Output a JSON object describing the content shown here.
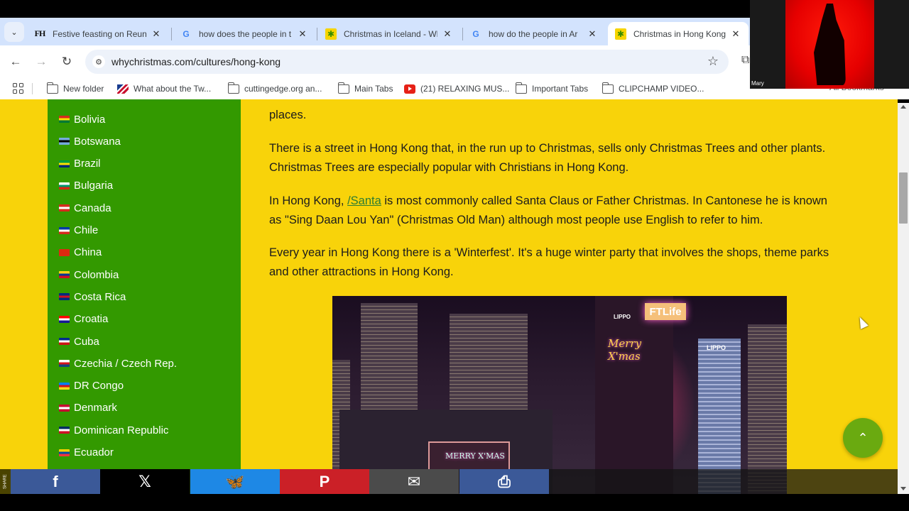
{
  "browser": {
    "tabs": [
      {
        "favicon": "fh-logo-icon",
        "title": "Festive feasting on Reunio",
        "active": false
      },
      {
        "favicon": "google-icon",
        "title": "how does the people in t",
        "active": false
      },
      {
        "favicon": "whychristmas-tree-icon",
        "title": "Christmas in Iceland - Wh",
        "active": false
      },
      {
        "favicon": "google-icon",
        "title": "how do the people in Ar",
        "active": false
      },
      {
        "favicon": "whychristmas-tree-icon",
        "title": "Christmas in Hong Kong",
        "active": true
      }
    ],
    "url": "whychristmas.com/cultures/hong-kong",
    "bookmarks": [
      {
        "icon": "folder-icon",
        "label": "New folder"
      },
      {
        "icon": "flag-favicon",
        "label": "What about the Tw..."
      },
      {
        "icon": "folder-icon",
        "label": "cuttingedge.org an..."
      },
      {
        "icon": "folder-icon",
        "label": "Main Tabs"
      },
      {
        "icon": "youtube-icon",
        "label": "(21) RELAXING MUS..."
      },
      {
        "icon": "folder-icon",
        "label": "Important Tabs"
      },
      {
        "icon": "folder-icon",
        "label": "CLIPCHAMP VIDEO..."
      },
      {
        "icon": "folder-icon",
        "label": "All Bookmarks"
      }
    ]
  },
  "webcam": {
    "participant_name": "Mary"
  },
  "sidebar": {
    "countries": [
      {
        "name": "Bolivia",
        "flag_colors": [
          "#d52b1e",
          "#f9e300",
          "#007934"
        ]
      },
      {
        "name": "Botswana",
        "flag_colors": [
          "#75aadb",
          "#000000",
          "#75aadb"
        ]
      },
      {
        "name": "Brazil",
        "flag_colors": [
          "#009c3b",
          "#ffdf00",
          "#002776"
        ]
      },
      {
        "name": "Bulgaria",
        "flag_colors": [
          "#ffffff",
          "#00966e",
          "#d62612"
        ]
      },
      {
        "name": "Canada",
        "flag_colors": [
          "#d52b1e",
          "#ffffff",
          "#d52b1e"
        ]
      },
      {
        "name": "Chile",
        "flag_colors": [
          "#0039a6",
          "#ffffff",
          "#d52b1e"
        ]
      },
      {
        "name": "China",
        "flag_colors": [
          "#de2910",
          "#de2910",
          "#de2910"
        ]
      },
      {
        "name": "Colombia",
        "flag_colors": [
          "#fcd116",
          "#003893",
          "#ce1126"
        ]
      },
      {
        "name": "Costa Rica",
        "flag_colors": [
          "#002b7f",
          "#ce1126",
          "#002b7f"
        ]
      },
      {
        "name": "Croatia",
        "flag_colors": [
          "#ff0000",
          "#ffffff",
          "#171796"
        ]
      },
      {
        "name": "Cuba",
        "flag_colors": [
          "#002a8f",
          "#ffffff",
          "#cb1515"
        ]
      },
      {
        "name": "Czechia / Czech Rep.",
        "flag_colors": [
          "#ffffff",
          "#d7141a",
          "#11457e"
        ]
      },
      {
        "name": "DR Congo",
        "flag_colors": [
          "#007fff",
          "#ce1021",
          "#f7d618"
        ]
      },
      {
        "name": "Denmark",
        "flag_colors": [
          "#c60c30",
          "#ffffff",
          "#c60c30"
        ]
      },
      {
        "name": "Dominican Republic",
        "flag_colors": [
          "#002d62",
          "#ffffff",
          "#ce1126"
        ]
      },
      {
        "name": "Ecuador",
        "flag_colors": [
          "#ffd100",
          "#034ea2",
          "#ef3340"
        ]
      }
    ]
  },
  "article": {
    "partial_line": "places.",
    "para1": "There is a street in Hong Kong that, in the run up to Christmas, sells only Christmas Trees and other plants. Christmas Trees are especially popular with Christians in Hong Kong.",
    "para2_before": "In Hong Kong, ",
    "para2_link": "/Santa",
    "para2_after": " is most commonly called Santa Claus or Father Christmas. In Cantonese he is known as \"Sing Daan Lou Yan\" (Christmas Old Man) although most people use English to refer to him.",
    "para3": "Every year in Hong Kong there is a 'Winterfest'. It's a huge winter party that involves the shops, theme parks and other attractions in Hong Kong.",
    "image": {
      "description": "Hong Kong skyline at night with Christmas light displays",
      "signs": [
        "FTLife",
        "LIPPO",
        "LIPPO",
        "Merry X'mas",
        "MERRY X'MAS"
      ]
    }
  },
  "share_bar": {
    "label": "SHARE",
    "buttons": [
      {
        "name": "facebook",
        "glyph": "f",
        "color": "#3b5998"
      },
      {
        "name": "x",
        "glyph": "𝕏",
        "color": "#000000"
      },
      {
        "name": "bluesky",
        "glyph": "🦋",
        "color": "#1e88e5"
      },
      {
        "name": "pinterest",
        "glyph": "P",
        "color": "#cb2027"
      },
      {
        "name": "email",
        "glyph": "✉",
        "color": "#4b4b4b"
      },
      {
        "name": "print",
        "glyph": "⎙",
        "color": "#3b5998"
      }
    ]
  },
  "colors": {
    "page_background": "#f8d30a",
    "sidebar_green": "#339900",
    "scroll_top_green": "#6aaa10",
    "link_green": "#2e7d32"
  }
}
